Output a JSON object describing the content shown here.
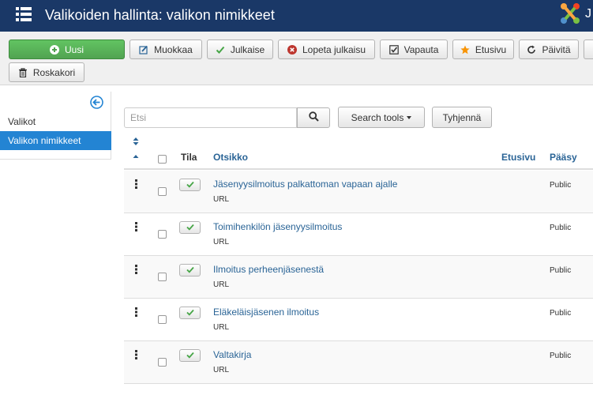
{
  "header": {
    "title": "Valikoiden hallinta: valikon nimikkeet"
  },
  "toolbar": {
    "buttons": [
      {
        "label": "Uusi",
        "icon": "plus-circle-icon"
      },
      {
        "label": "Muokkaa",
        "icon": "edit-icon"
      },
      {
        "label": "Julkaise",
        "icon": "check-icon"
      },
      {
        "label": "Lopeta julkaisu",
        "icon": "unpublish-icon"
      },
      {
        "label": "Vapauta",
        "icon": "checkbox-icon"
      },
      {
        "label": "Etusivu",
        "icon": "star-icon"
      },
      {
        "label": "Päivitä",
        "icon": "refresh-icon"
      },
      {
        "label": "Roskakori",
        "icon": "trash-icon"
      }
    ],
    "accent_color": "#5cb85c"
  },
  "sidebar": {
    "items": [
      {
        "label": "Valikot",
        "active": false
      },
      {
        "label": "Valikon nimikkeet",
        "active": true
      }
    ]
  },
  "filters": {
    "search_placeholder": "Etsi",
    "search_tools_label": "Search tools",
    "clear_label": "Tyhjennä"
  },
  "table": {
    "headers": {
      "status": "Tila",
      "title": "Otsikko",
      "home": "Etusivu",
      "access": "Pääsy"
    },
    "rows": [
      {
        "title": "Jäsenyysilmoitus palkattoman vapaan ajalle",
        "type": "URL",
        "access": "Public"
      },
      {
        "title": "Toimihenkilön jäsenyysilmoitus",
        "type": "URL",
        "access": "Public"
      },
      {
        "title": "Ilmoitus perheenjäsenestä",
        "type": "URL",
        "access": "Public"
      },
      {
        "title": "Eläkeläisjäsenen ilmoitus",
        "type": "URL",
        "access": "Public"
      },
      {
        "title": "Valtakirja",
        "type": "URL",
        "access": "Public"
      }
    ]
  },
  "colors": {
    "header_bg": "#1a3867",
    "link": "#2a6496",
    "active_sidebar": "#2384d3",
    "published": "#46a546"
  }
}
